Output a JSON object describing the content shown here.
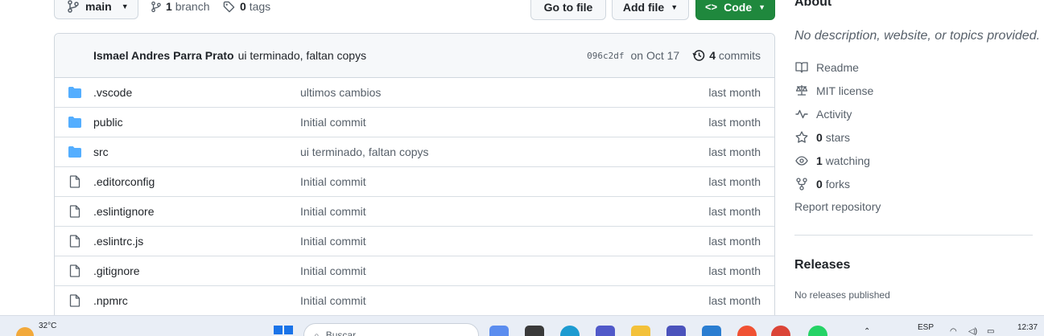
{
  "toolbar": {
    "branch_label": "main",
    "branches_count": "1",
    "branches_label": "branch",
    "tags_count": "0",
    "tags_label": "tags",
    "go_to_file": "Go to file",
    "add_file": "Add file",
    "code": "Code"
  },
  "latest_commit": {
    "author": "Ismael Andres Parra Prato",
    "message": "ui terminado, faltan copys",
    "sha": "096c2df",
    "date": "on Oct 17",
    "commits_count": "4",
    "commits_label": "commits"
  },
  "files": [
    {
      "type": "folder",
      "name": ".vscode",
      "message": "ultimos cambios",
      "date": "last month"
    },
    {
      "type": "folder",
      "name": "public",
      "message": "Initial commit",
      "date": "last month"
    },
    {
      "type": "folder",
      "name": "src",
      "message": "ui terminado, faltan copys",
      "date": "last month"
    },
    {
      "type": "file",
      "name": ".editorconfig",
      "message": "Initial commit",
      "date": "last month"
    },
    {
      "type": "file",
      "name": ".eslintignore",
      "message": "Initial commit",
      "date": "last month"
    },
    {
      "type": "file",
      "name": ".eslintrc.js",
      "message": "Initial commit",
      "date": "last month"
    },
    {
      "type": "file",
      "name": ".gitignore",
      "message": "Initial commit",
      "date": "last month"
    },
    {
      "type": "file",
      "name": ".npmrc",
      "message": "Initial commit",
      "date": "last month"
    }
  ],
  "about": {
    "title": "About",
    "description": "No description, website, or topics provided.",
    "readme": "Readme",
    "license": "MIT license",
    "activity": "Activity",
    "stars_count": "0",
    "stars_label": "stars",
    "watching_count": "1",
    "watching_label": "watching",
    "forks_count": "0",
    "forks_label": "forks",
    "report": "Report repository"
  },
  "releases": {
    "title": "Releases",
    "none": "No releases published"
  },
  "taskbar": {
    "temperature": "32°C",
    "search_placeholder": "Buscar",
    "language": "ESP",
    "time": "12:37"
  },
  "colors": {
    "accent_green": "#1f883d",
    "folder_blue": "#54aeff",
    "muted_text": "#57606a"
  }
}
